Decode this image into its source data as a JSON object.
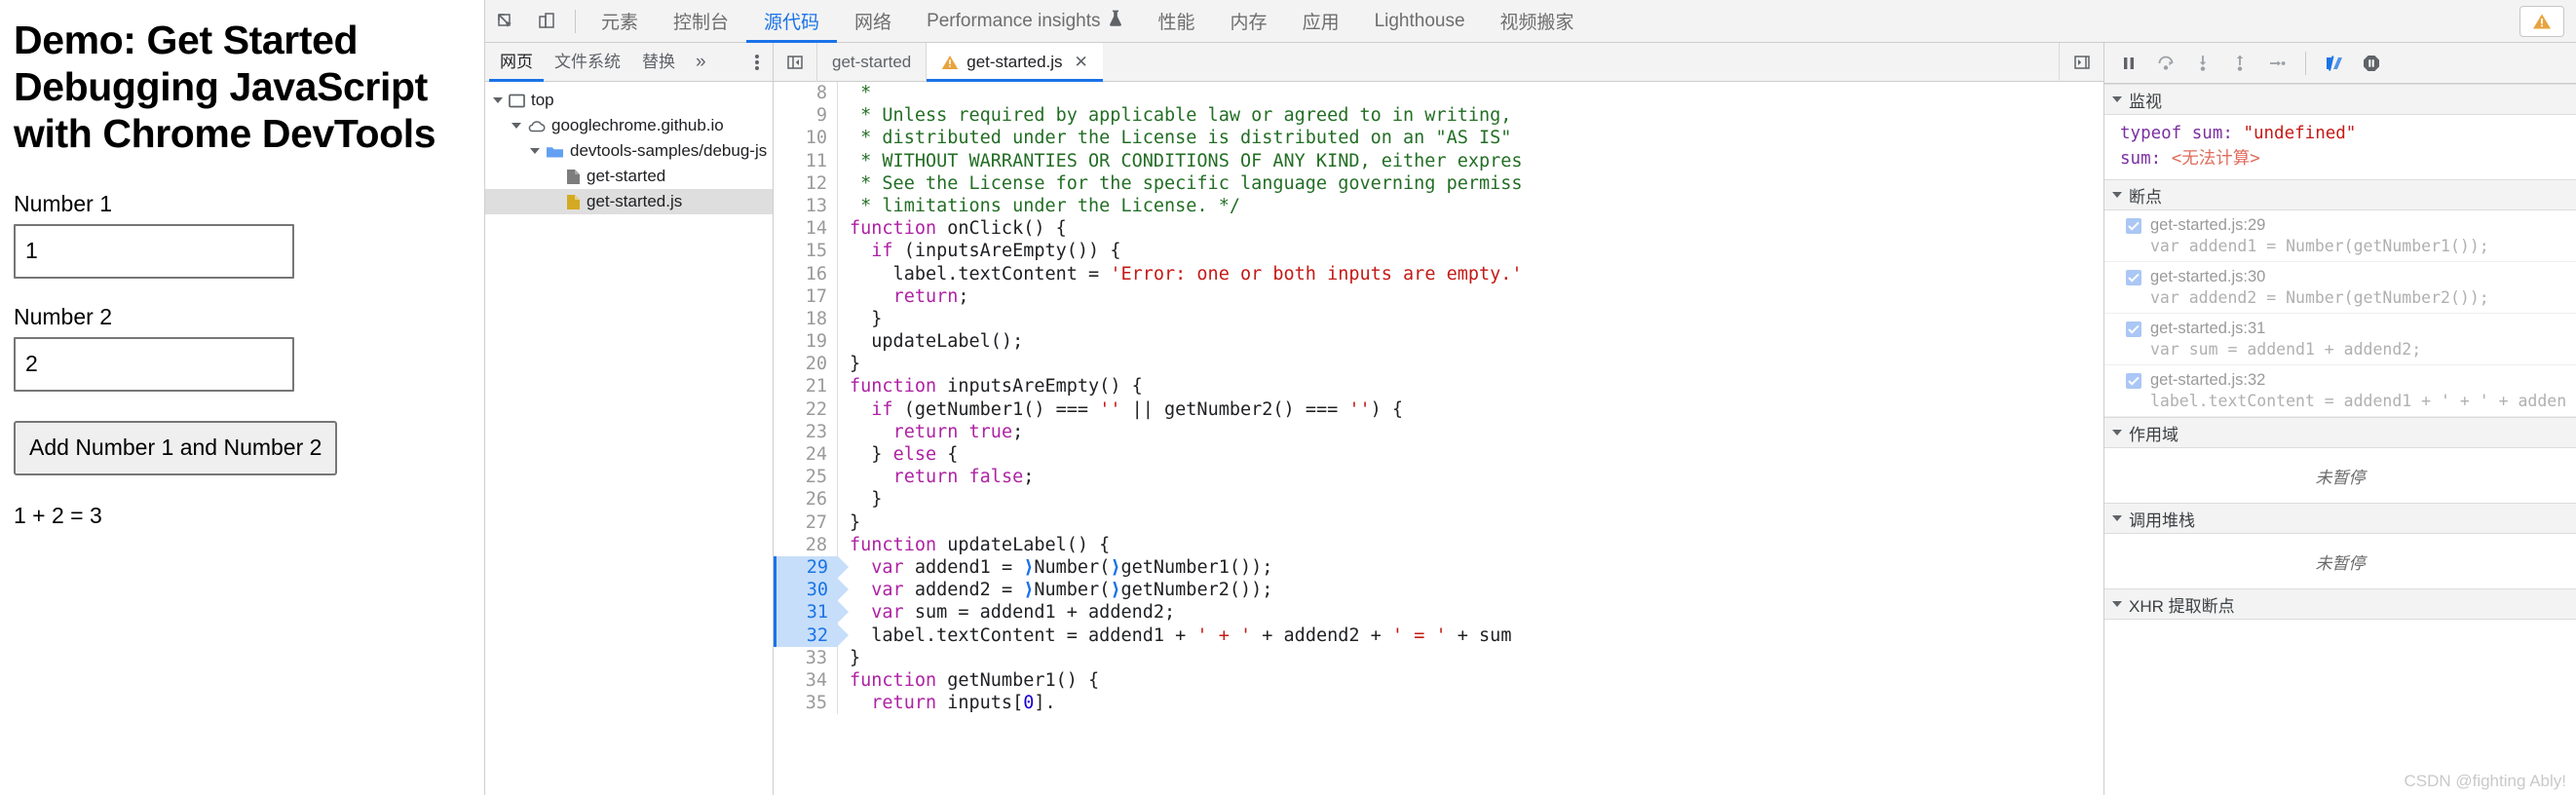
{
  "demo_page": {
    "title": "Demo: Get Started Debugging JavaScript with Chrome DevTools",
    "label1": "Number 1",
    "value1": "1",
    "label2": "Number 2",
    "value2": "2",
    "button": "Add Number 1 and Number 2",
    "result": "1 + 2 = 3"
  },
  "devtools": {
    "main_tabs": [
      {
        "label": "元素",
        "active": false
      },
      {
        "label": "控制台",
        "active": false
      },
      {
        "label": "源代码",
        "active": true
      },
      {
        "label": "网络",
        "active": false
      },
      {
        "label": "Performance insights",
        "active": false,
        "icon": "flask-icon"
      },
      {
        "label": "性能",
        "active": false
      },
      {
        "label": "内存",
        "active": false
      },
      {
        "label": "应用",
        "active": false
      },
      {
        "label": "Lighthouse",
        "active": false
      },
      {
        "label": "视频搬家",
        "active": false
      }
    ],
    "warning_badge_color": "#e8a33d",
    "navigator": {
      "tabs": [
        {
          "label": "网页",
          "active": true
        },
        {
          "label": "文件系统",
          "active": false
        },
        {
          "label": "替换",
          "active": false
        }
      ],
      "more_label": "»",
      "tree": [
        {
          "label": "top",
          "depth": 0,
          "icon": "frame-icon",
          "expanded": true,
          "selected": false
        },
        {
          "label": "googlechrome.github.io",
          "depth": 1,
          "icon": "cloud-icon",
          "expanded": true,
          "selected": false
        },
        {
          "label": "devtools-samples/debug-js",
          "depth": 2,
          "icon": "folder-icon",
          "expanded": true,
          "selected": false
        },
        {
          "label": "get-started",
          "depth": 3,
          "icon": "document-icon",
          "expanded": null,
          "selected": false
        },
        {
          "label": "get-started.js",
          "depth": 3,
          "icon": "js-file-icon",
          "expanded": null,
          "selected": true
        }
      ]
    },
    "editor": {
      "tabs": [
        {
          "label": "get-started",
          "active": false,
          "warning": false,
          "closable": false
        },
        {
          "label": "get-started.js",
          "active": true,
          "warning": true,
          "closable": true
        }
      ],
      "close_glyph": "✕",
      "lines": [
        {
          "n": 8,
          "bp": false,
          "tokens": [
            {
              "t": " * ",
              "c": "cmt"
            }
          ]
        },
        {
          "n": 9,
          "bp": false,
          "tokens": [
            {
              "t": " * Unless required by applicable law or agreed to in writing,",
              "c": "cmt"
            }
          ]
        },
        {
          "n": 10,
          "bp": false,
          "tokens": [
            {
              "t": " * distributed under the License is distributed on an \"AS IS\"",
              "c": "cmt"
            }
          ]
        },
        {
          "n": 11,
          "bp": false,
          "tokens": [
            {
              "t": " * WITHOUT WARRANTIES OR CONDITIONS OF ANY KIND, either expres",
              "c": "cmt"
            }
          ]
        },
        {
          "n": 12,
          "bp": false,
          "tokens": [
            {
              "t": " * See the License for the specific language governing permiss",
              "c": "cmt"
            }
          ]
        },
        {
          "n": 13,
          "bp": false,
          "tokens": [
            {
              "t": " * limitations under the License. */",
              "c": "cmt"
            }
          ]
        },
        {
          "n": 14,
          "bp": false,
          "tokens": [
            {
              "t": "function",
              "c": "kw"
            },
            {
              "t": " onClick() {",
              "c": ""
            }
          ]
        },
        {
          "n": 15,
          "bp": false,
          "tokens": [
            {
              "t": "  ",
              "c": ""
            },
            {
              "t": "if",
              "c": "kw"
            },
            {
              "t": " (inputsAreEmpty()) {",
              "c": ""
            }
          ]
        },
        {
          "n": 16,
          "bp": false,
          "tokens": [
            {
              "t": "    label.textContent = ",
              "c": ""
            },
            {
              "t": "'Error: one or both inputs are empty.'",
              "c": "str"
            }
          ]
        },
        {
          "n": 17,
          "bp": false,
          "tokens": [
            {
              "t": "    ",
              "c": ""
            },
            {
              "t": "return",
              "c": "kw"
            },
            {
              "t": ";",
              "c": ""
            }
          ]
        },
        {
          "n": 18,
          "bp": false,
          "tokens": [
            {
              "t": "  }",
              "c": ""
            }
          ]
        },
        {
          "n": 19,
          "bp": false,
          "tokens": [
            {
              "t": "  updateLabel();",
              "c": ""
            }
          ]
        },
        {
          "n": 20,
          "bp": false,
          "tokens": [
            {
              "t": "}",
              "c": ""
            }
          ]
        },
        {
          "n": 21,
          "bp": false,
          "tokens": [
            {
              "t": "function",
              "c": "kw"
            },
            {
              "t": " inputsAreEmpty() {",
              "c": ""
            }
          ]
        },
        {
          "n": 22,
          "bp": false,
          "tokens": [
            {
              "t": "  ",
              "c": ""
            },
            {
              "t": "if",
              "c": "kw"
            },
            {
              "t": " (getNumber1() === ",
              "c": ""
            },
            {
              "t": "''",
              "c": "str"
            },
            {
              "t": " || getNumber2() === ",
              "c": ""
            },
            {
              "t": "''",
              "c": "str"
            },
            {
              "t": ") {",
              "c": ""
            }
          ]
        },
        {
          "n": 23,
          "bp": false,
          "tokens": [
            {
              "t": "    ",
              "c": ""
            },
            {
              "t": "return",
              "c": "kw"
            },
            {
              "t": " ",
              "c": ""
            },
            {
              "t": "true",
              "c": "kw"
            },
            {
              "t": ";",
              "c": ""
            }
          ]
        },
        {
          "n": 24,
          "bp": false,
          "tokens": [
            {
              "t": "  } ",
              "c": ""
            },
            {
              "t": "else",
              "c": "kw"
            },
            {
              "t": " {",
              "c": ""
            }
          ]
        },
        {
          "n": 25,
          "bp": false,
          "tokens": [
            {
              "t": "    ",
              "c": ""
            },
            {
              "t": "return",
              "c": "kw"
            },
            {
              "t": " ",
              "c": ""
            },
            {
              "t": "false",
              "c": "kw"
            },
            {
              "t": ";",
              "c": ""
            }
          ]
        },
        {
          "n": 26,
          "bp": false,
          "tokens": [
            {
              "t": "  }",
              "c": ""
            }
          ]
        },
        {
          "n": 27,
          "bp": false,
          "tokens": [
            {
              "t": "}",
              "c": ""
            }
          ]
        },
        {
          "n": 28,
          "bp": false,
          "tokens": [
            {
              "t": "function",
              "c": "kw"
            },
            {
              "t": " updateLabel() {",
              "c": ""
            }
          ]
        },
        {
          "n": 29,
          "bp": true,
          "tokens": [
            {
              "t": "  ",
              "c": ""
            },
            {
              "t": "var",
              "c": "kw"
            },
            {
              "t": " addend1 = ",
              "c": ""
            },
            {
              "t": "⟩",
              "c": "chev"
            },
            {
              "t": "Number(",
              "c": ""
            },
            {
              "t": "⟩",
              "c": "chev"
            },
            {
              "t": "getNumber1());",
              "c": ""
            }
          ]
        },
        {
          "n": 30,
          "bp": true,
          "tokens": [
            {
              "t": "  ",
              "c": ""
            },
            {
              "t": "var",
              "c": "kw"
            },
            {
              "t": " addend2 = ",
              "c": ""
            },
            {
              "t": "⟩",
              "c": "chev"
            },
            {
              "t": "Number(",
              "c": ""
            },
            {
              "t": "⟩",
              "c": "chev"
            },
            {
              "t": "getNumber2());",
              "c": ""
            }
          ]
        },
        {
          "n": 31,
          "bp": true,
          "tokens": [
            {
              "t": "  ",
              "c": ""
            },
            {
              "t": "var",
              "c": "kw"
            },
            {
              "t": " sum = addend1 + addend2;",
              "c": ""
            }
          ]
        },
        {
          "n": 32,
          "bp": true,
          "tokens": [
            {
              "t": "  label.textContent = addend1 + ",
              "c": ""
            },
            {
              "t": "' + '",
              "c": "str"
            },
            {
              "t": " + addend2 + ",
              "c": ""
            },
            {
              "t": "' = '",
              "c": "str"
            },
            {
              "t": " + sum",
              "c": ""
            }
          ]
        },
        {
          "n": 33,
          "bp": false,
          "tokens": [
            {
              "t": "}",
              "c": ""
            }
          ]
        },
        {
          "n": 34,
          "bp": false,
          "tokens": [
            {
              "t": "function",
              "c": "kw"
            },
            {
              "t": " getNumber1() {",
              "c": ""
            }
          ]
        },
        {
          "n": 35,
          "bp": false,
          "tokens": [
            {
              "t": "  ",
              "c": ""
            },
            {
              "t": "return",
              "c": "kw"
            },
            {
              "t": " inputs[",
              "c": ""
            },
            {
              "t": "0",
              "c": "num"
            },
            {
              "t": "].",
              "c": ""
            }
          ]
        }
      ]
    },
    "debugger": {
      "toolbar_buttons": [
        {
          "name": "resume-script-button",
          "glyph": "pause"
        },
        {
          "name": "step-over-button",
          "glyph": "step-over"
        },
        {
          "name": "step-into-button",
          "glyph": "step-into"
        },
        {
          "name": "step-out-button",
          "glyph": "step-out"
        },
        {
          "name": "step-button",
          "glyph": "step"
        },
        {
          "name": "deactivate-breakpoints-button",
          "glyph": "deactivate"
        },
        {
          "name": "pause-on-exceptions-button",
          "glyph": "pause-exceptions"
        }
      ],
      "watch": {
        "title": "监视",
        "items": [
          {
            "name": "typeof sum",
            "value": "\"undefined\"",
            "kind": "string"
          },
          {
            "name": "sum",
            "value": "<无法计算>",
            "kind": "error"
          }
        ]
      },
      "breakpoints": {
        "title": "断点",
        "items": [
          {
            "location": "get-started.js:29",
            "code": "var addend1 = Number(getNumber1());",
            "checked": true
          },
          {
            "location": "get-started.js:30",
            "code": "var addend2 = Number(getNumber2());",
            "checked": true
          },
          {
            "location": "get-started.js:31",
            "code": "var sum = addend1 + addend2;",
            "checked": true
          },
          {
            "location": "get-started.js:32",
            "code": "label.textContent = addend1 + ' + ' + adden",
            "checked": true
          }
        ]
      },
      "scope": {
        "title": "作用域",
        "empty": "未暂停"
      },
      "call_stack": {
        "title": "调用堆栈",
        "empty": "未暂停"
      },
      "xhr_breakpoints": {
        "title": "XHR 提取断点"
      }
    },
    "watermark": "CSDN @fighting Ably!"
  }
}
